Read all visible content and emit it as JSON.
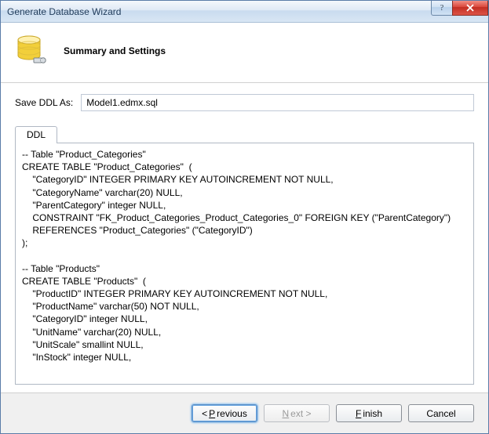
{
  "window": {
    "title": "Generate Database Wizard",
    "help_tooltip": "?",
    "close_tooltip": "Close"
  },
  "header": {
    "title": "Summary and Settings"
  },
  "save": {
    "label": "Save DDL As:",
    "value": "Model1.edmx.sql"
  },
  "tabs": {
    "ddl": "DDL"
  },
  "ddl": {
    "content": "-- Table \"Product_Categories\"\nCREATE TABLE \"Product_Categories\"  (\n    \"CategoryID\" INTEGER PRIMARY KEY AUTOINCREMENT NOT NULL,\n    \"CategoryName\" varchar(20) NULL,\n    \"ParentCategory\" integer NULL,\n    CONSTRAINT \"FK_Product_Categories_Product_Categories_0\" FOREIGN KEY (\"ParentCategory\")\n    REFERENCES \"Product_Categories\" (\"CategoryID\")\n);\n\n-- Table \"Products\"\nCREATE TABLE \"Products\"  (\n    \"ProductID\" INTEGER PRIMARY KEY AUTOINCREMENT NOT NULL,\n    \"ProductName\" varchar(50) NOT NULL,\n    \"CategoryID\" integer NULL,\n    \"UnitName\" varchar(20) NULL,\n    \"UnitScale\" smallint NULL,\n    \"InStock\" integer NULL,"
  },
  "buttons": {
    "previous": {
      "prefix": "< ",
      "accel": "P",
      "rest": "revious"
    },
    "next": {
      "accel": "N",
      "rest": "ext >"
    },
    "finish": {
      "accel": "F",
      "rest": "inish"
    },
    "cancel": {
      "label": "Cancel"
    }
  }
}
